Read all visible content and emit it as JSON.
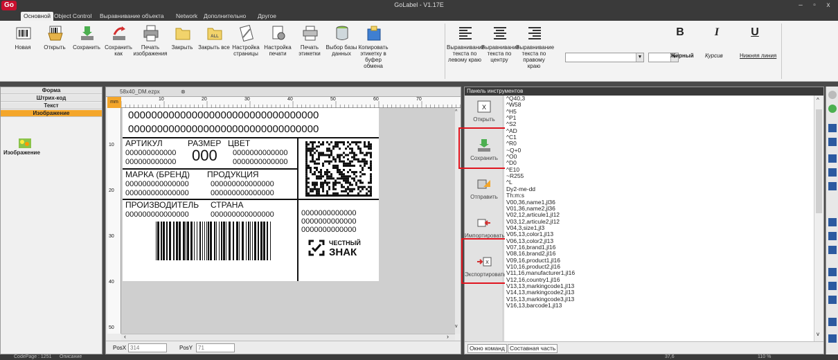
{
  "titlebar": {
    "logo": "Go",
    "title": "GoLabel - V1.17E",
    "min": "–",
    "max": "▫",
    "close": "x"
  },
  "tabs": [
    {
      "label": "Основной"
    },
    {
      "label": "Object Control"
    },
    {
      "label": "Выравнивание объекта"
    },
    {
      "label": "Network"
    },
    {
      "label": "Дополнительно"
    },
    {
      "label": "Другое"
    }
  ],
  "ribbon": {
    "buttons": [
      {
        "label": "Новая",
        "icon": "barcode-new-icon"
      },
      {
        "label": "Открыть",
        "icon": "open-icon"
      },
      {
        "label": "Сохранить",
        "icon": "save-icon"
      },
      {
        "label": "Сохранить как",
        "icon": "save-as-icon"
      },
      {
        "label": "Печать изображения",
        "icon": "print-image-icon"
      },
      {
        "label": "Закрыть",
        "icon": "folder-close-icon"
      },
      {
        "label": "Закрыть все",
        "icon": "close-all-icon"
      },
      {
        "label": "Настройка страницы",
        "icon": "page-setup-icon"
      },
      {
        "label": "Настройка печати",
        "icon": "print-setup-icon"
      },
      {
        "label": "Печать этикетки",
        "icon": "print-label-icon"
      },
      {
        "label": "Выбор базы данных",
        "icon": "database-icon"
      },
      {
        "label": "Копировать этикетку в буфер обмена",
        "icon": "copy-clipboard-icon"
      }
    ],
    "align": [
      {
        "label": "Выравнивание текста по левому краю"
      },
      {
        "label": "Выравнивание текста по центру"
      },
      {
        "label": "Выравнивание текста по правому краю"
      }
    ],
    "format": {
      "bold": "B",
      "bold_label": "Жирный",
      "italic": "I",
      "italic_label": "Курсив",
      "underline": "U",
      "underline_label": "Нижняя линия"
    },
    "all_icon_text": "ALL"
  },
  "left_panel": {
    "sections": [
      {
        "label": "Форма"
      },
      {
        "label": "Штрих-код"
      },
      {
        "label": "Текст"
      },
      {
        "label": "Изображение"
      }
    ],
    "item_label": "Изображение"
  },
  "editor": {
    "doc_tab": "58x40_DM.ezpx",
    "unit": "mm",
    "ruler_h": [
      "10",
      "20",
      "30",
      "40",
      "50",
      "60",
      "70"
    ],
    "ruler_v": [
      "10",
      "20",
      "30",
      "40",
      "50"
    ],
    "posx_label": "PosX",
    "posx_value": "314",
    "posy_label": "PosY",
    "posy_value": "71"
  },
  "label": {
    "line1": "000000000000000000000000000000000",
    "line2": "000000000000000000000000000000000",
    "artikul": "АРТИКУЛ",
    "razmer": "РАЗМЕР",
    "cvet": "ЦВЕТ",
    "art1": "000000000000",
    "art2": "000000000000",
    "size": "000",
    "color1": "0000000000000",
    "color2": "0000000000000",
    "brand": "МАРКА (БРЕНД)",
    "product": "ПРОДУКЦИЯ",
    "brand1": "000000000000000",
    "brand2": "000000000000000",
    "prod1": "000000000000000",
    "prod2": "000000000000000",
    "manufacturer": "ПРОИЗВОДИТЕЛЬ",
    "country": "СТРАНА",
    "manuf1": "000000000000000",
    "country1": "000000000000000",
    "code1": "0000000000000",
    "code2": "0000000000000",
    "code3": "0000000000000",
    "mark_line1": "ЧЕСТНЫЙ",
    "mark_line2": "ЗНАК"
  },
  "toolbox": {
    "title": "Панель инструментов",
    "buttons": [
      {
        "label": "Открыть"
      },
      {
        "label": "Сохранить"
      },
      {
        "label": "Отправить"
      },
      {
        "label": "Импортировать"
      },
      {
        "label": "Экспортировать"
      }
    ],
    "commands": [
      "^Q40,3",
      "^W58",
      "^H5",
      "^P1",
      "^S2",
      "^AD",
      "^C1",
      "^R0",
      "~Q+0",
      "^O0",
      "^D0",
      "^E10",
      "~R255",
      "^L",
      "Dy2-me-dd",
      "Th:m:s",
      "V00,36,name1,jl36",
      "V01,36,name2,jl36",
      "V02,12,articule1,jl12",
      "V03,12,articule2,jl12",
      "V04,3,size1,jl3",
      "V05,13,color1,jl13",
      "V06,13,color2,jl13",
      "V07,16,brand1,jl16",
      "V08,16,brand2,jl16",
      "V09,16,product1,jl16",
      "V10,16,product2,jl16",
      "V11,16,manufacturer1,jl16",
      "V12,16,country1,jl16",
      "V13,13,markingcode1,jl13",
      "V14,13,markingcode2,jl13",
      "V15,13,markingcode3,jl13",
      "V16,13,barcode1,jl13"
    ],
    "foot_tabs": [
      {
        "label": "Окно команд"
      },
      {
        "label": "Составная часть"
      }
    ]
  },
  "statusbar": {
    "left": "CodePage : 1251",
    "desc": "Описание",
    "coord": "37,6",
    "zoom": "110 %"
  },
  "colors": {
    "accent": "#f4a62a",
    "highlight_box": "#e0141e",
    "titlebar": "#3a3a3a"
  }
}
